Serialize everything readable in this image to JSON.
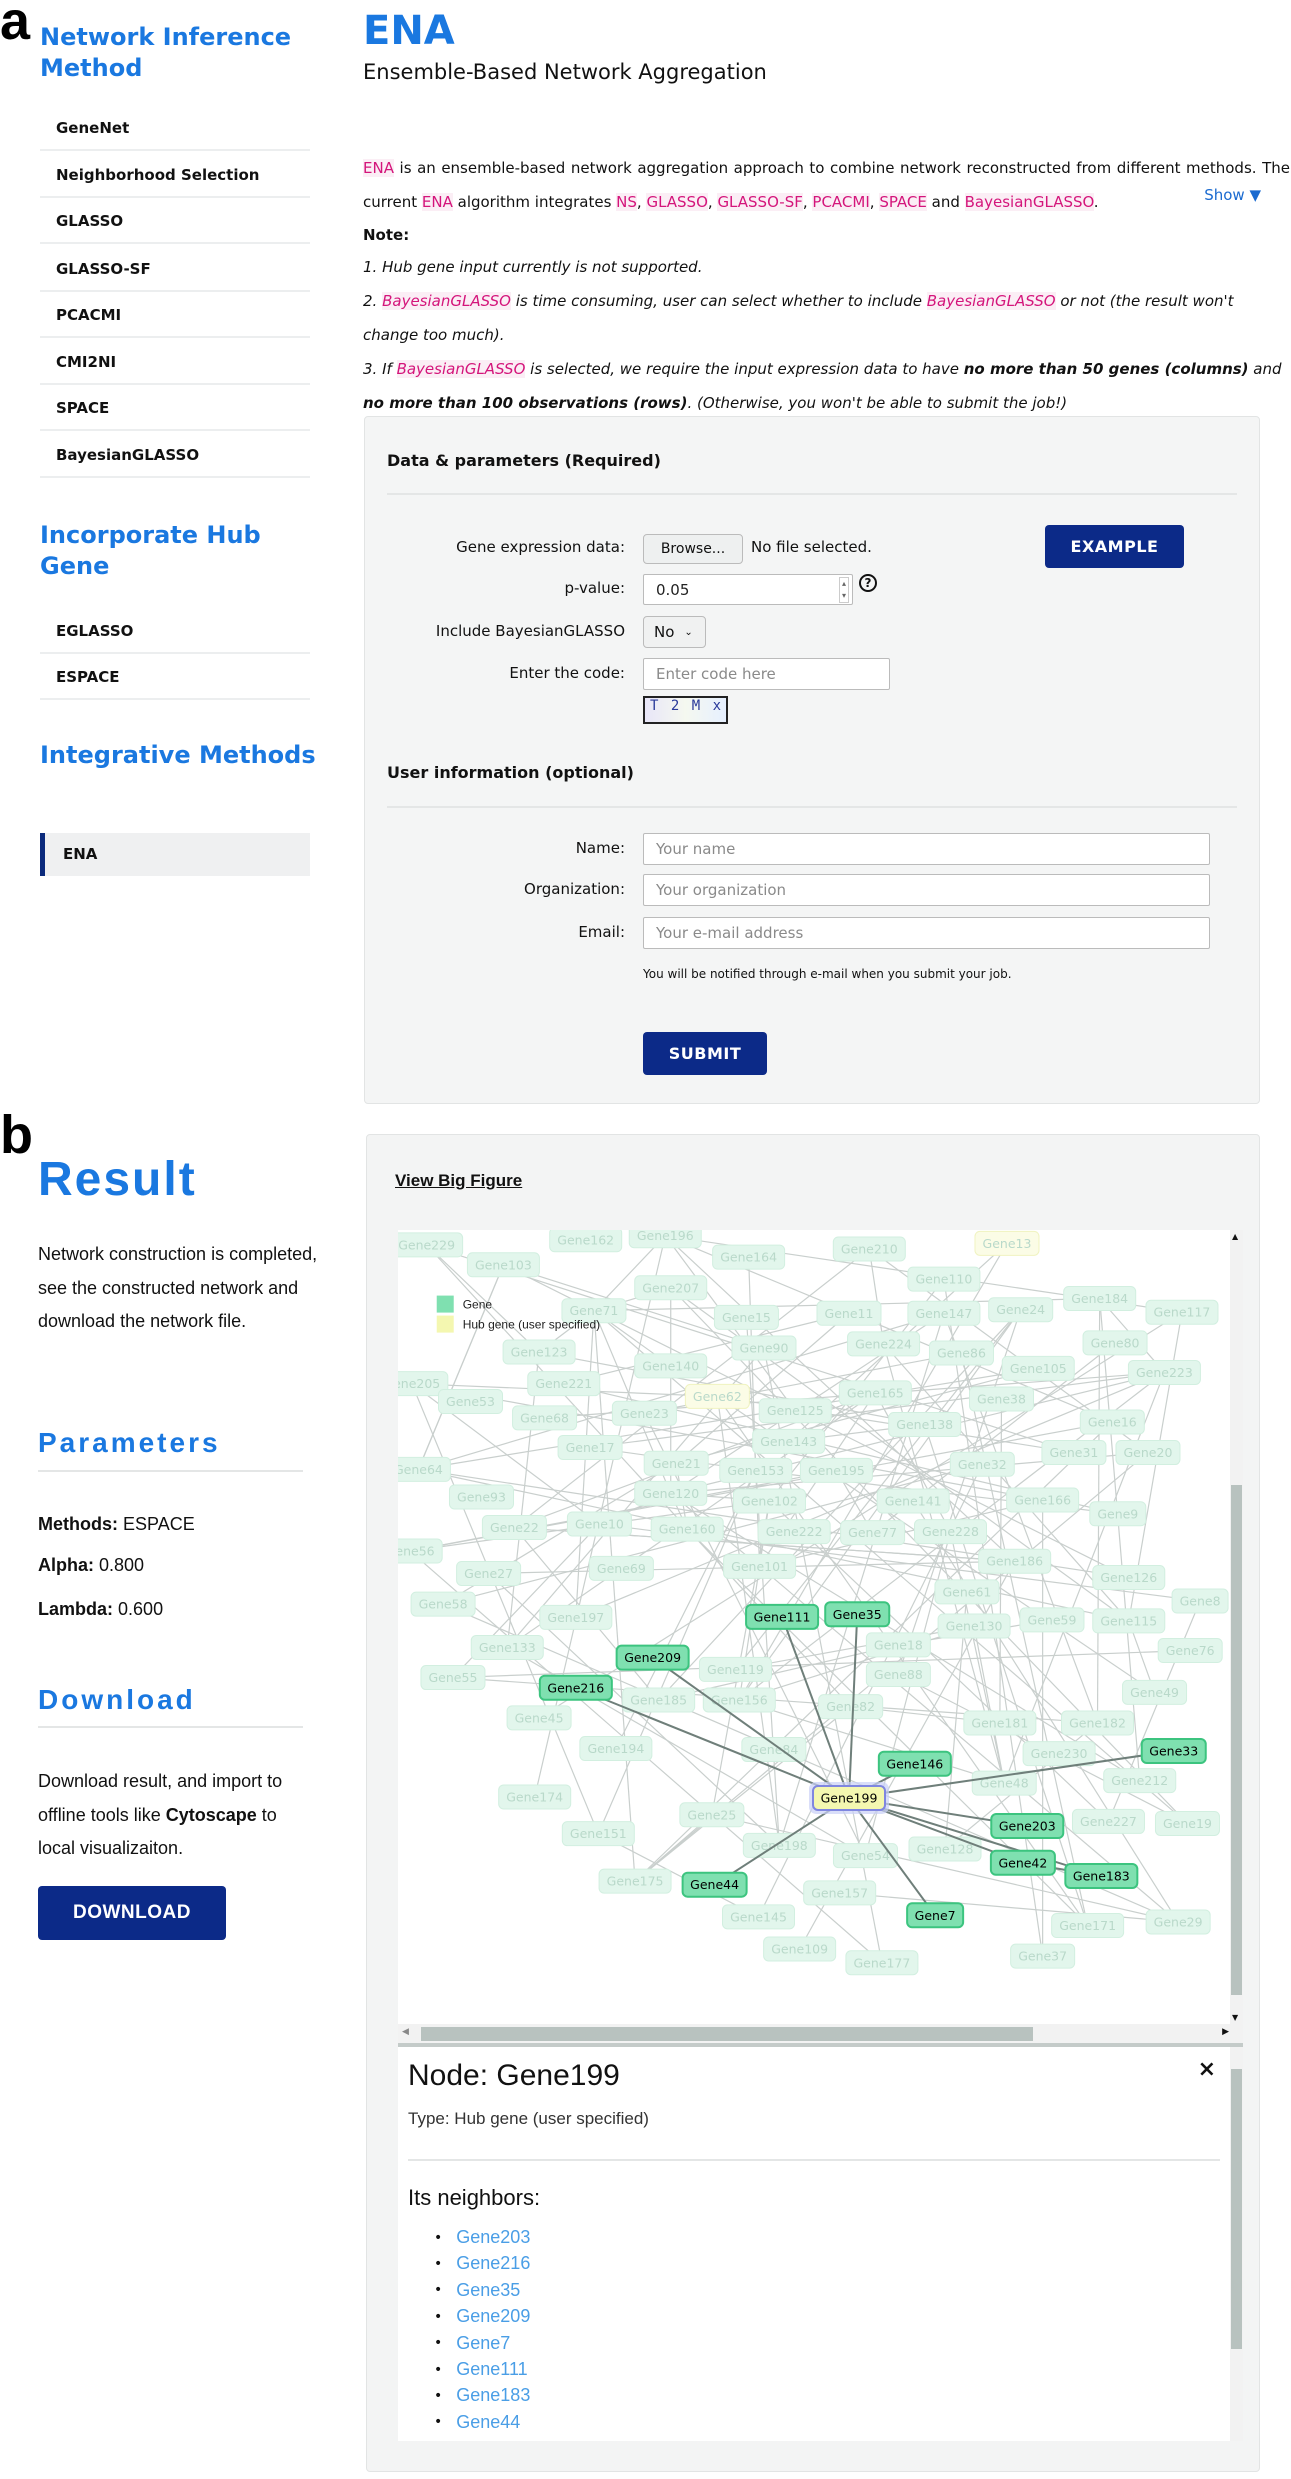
{
  "labels": {
    "a": "a",
    "b": "b"
  },
  "sidebar": {
    "section1": "Network Inference Method",
    "items1": [
      "GeneNet",
      "Neighborhood Selection",
      "GLASSO",
      "GLASSO-SF",
      "PCACMI",
      "CMI2NI",
      "SPACE",
      "BayesianGLASSO"
    ],
    "section2": "Incorporate Hub Gene",
    "items2": [
      "EGLASSO",
      "ESPACE"
    ],
    "section3": "Integrative Methods",
    "items3": [
      "ENA"
    ],
    "active_item": "ENA"
  },
  "header": {
    "title": "ENA",
    "subtitle": "Ensemble-Based Network Aggregation"
  },
  "intro": [
    {
      "t": "ENA",
      "s": "pink"
    },
    {
      "t": " is an ensemble-based network aggregation approach to combine network reconstructed from different methods. The current "
    },
    {
      "t": "ENA",
      "s": "pink"
    },
    {
      "t": " algorithm integrates "
    },
    {
      "t": "NS",
      "s": "pink"
    },
    {
      "t": ", "
    },
    {
      "t": "GLASSO",
      "s": "pink"
    },
    {
      "t": ", "
    },
    {
      "t": "GLASSO-SF",
      "s": "pink"
    },
    {
      "t": ", "
    },
    {
      "t": "PCACMI",
      "s": "pink"
    },
    {
      "t": ", "
    },
    {
      "t": "SPACE",
      "s": "pink"
    },
    {
      "t": " and "
    },
    {
      "t": "BayesianGLASSO",
      "s": "pink"
    },
    {
      "t": "."
    }
  ],
  "show_toggle": "Show ▼",
  "note": {
    "title": "Note:",
    "lines": [
      [
        {
          "t": "1. Hub gene input currently is not supported."
        }
      ],
      [
        {
          "t": "2. "
        },
        {
          "t": "BayesianGLASSO",
          "s": "pink"
        },
        {
          "t": " is time consuming, user can select whether to include "
        },
        {
          "t": "BayesianGLASSO",
          "s": "pink"
        },
        {
          "t": " or not (the result won't change too much)."
        }
      ],
      [
        {
          "t": "3. If "
        },
        {
          "t": "BayesianGLASSO",
          "s": "pink"
        },
        {
          "t": " is selected, we require the input expression data to have "
        },
        {
          "t": "no more than 50 genes (columns)",
          "s": "b"
        },
        {
          "t": " and "
        },
        {
          "t": "no more than 100 observations (rows)",
          "s": "b"
        },
        {
          "t": ". (Otherwise, you won't be able to submit the job!)"
        }
      ]
    ]
  },
  "form": {
    "section_required": "Data & parameters (Required)",
    "gene_expr_label": "Gene expression data:",
    "browse_label": "Browse...",
    "no_file": "No file selected.",
    "example_label": "EXAMPLE",
    "pvalue_label": "p-value:",
    "pvalue_value": "0.05",
    "help_icon": "?",
    "bayes_label": "Include BayesianGLASSO",
    "bayes_value": "No",
    "code_label": "Enter the code:",
    "code_placeholder": "Enter code here",
    "captcha": "T 2 M x",
    "section_optional": "User information (optional)",
    "name_label": "Name:",
    "name_placeholder": "Your name",
    "org_label": "Organization:",
    "org_placeholder": "Your organization",
    "email_label": "Email:",
    "email_placeholder": "Your e-mail address",
    "notify_text": "You will be notified through e-mail when you submit your job.",
    "submit_label": "SUBMIT"
  },
  "result": {
    "title": "Result",
    "description": "Network construction is completed, see the constructed network and download the network file.",
    "parameters_title": "Parameters",
    "params": [
      {
        "key": "Methods:",
        "value": "ESPACE"
      },
      {
        "key": "Alpha:",
        "value": "0.800"
      },
      {
        "key": "Lambda:",
        "value": "0.600"
      }
    ],
    "download_title": "Download",
    "download_text_1": "Download result, and import to offline tools like ",
    "download_text_bold": "Cytoscape",
    "download_text_2": " to local visualizaiton.",
    "download_label": "DOWNLOAD"
  },
  "network": {
    "view_big_figure": "View Big Figure",
    "legend": [
      {
        "label": "Gene",
        "color": "#7fe0b0"
      },
      {
        "label": "Hub gene (user specified)",
        "color": "#f4f7b0"
      }
    ],
    "colors": {
      "gene": "#7fe0b0",
      "hub": "#f4f7b0",
      "faded": "#e2f6ec",
      "edge": "#9aa6a2"
    },
    "selected": "Gene199",
    "highlighted": [
      "Gene199",
      "Gene111",
      "Gene35",
      "Gene209",
      "Gene216",
      "Gene146",
      "Gene33",
      "Gene203",
      "Gene42",
      "Gene183",
      "Gene44",
      "Gene7"
    ],
    "highlighted_edges": [
      [
        "Gene199",
        "Gene111"
      ],
      [
        "Gene199",
        "Gene35"
      ],
      [
        "Gene199",
        "Gene209"
      ],
      [
        "Gene199",
        "Gene216"
      ],
      [
        "Gene199",
        "Gene146"
      ],
      [
        "Gene199",
        "Gene33"
      ],
      [
        "Gene199",
        "Gene203"
      ],
      [
        "Gene199",
        "Gene42"
      ],
      [
        "Gene199",
        "Gene183"
      ],
      [
        "Gene199",
        "Gene44"
      ],
      [
        "Gene199",
        "Gene7"
      ],
      [
        "Gene42",
        "Gene183"
      ]
    ],
    "faded_hubs": [
      "Gene13",
      "Gene62"
    ],
    "faded": [
      "Gene229",
      "Gene162",
      "Gene196",
      "Gene103",
      "Gene164",
      "Gene210",
      "Gene13",
      "Gene207",
      "Gene71",
      "Gene110",
      "Gene15",
      "Gene11",
      "Gene147",
      "Gene24",
      "Gene184",
      "Gene117",
      "Gene123",
      "Gene90",
      "Gene224",
      "Gene86",
      "Gene80",
      "Gene140",
      "Gene105",
      "Gene223",
      "Gene205",
      "Gene221",
      "Gene53",
      "Gene62",
      "Gene165",
      "Gene38",
      "Gene68",
      "Gene23",
      "Gene125",
      "Gene138",
      "Gene16",
      "Gene17",
      "Gene143",
      "Gene31",
      "Gene20",
      "Gene32",
      "Gene64",
      "Gene21",
      "Gene153",
      "Gene195",
      "Gene93",
      "Gene120",
      "Gene102",
      "Gene141",
      "Gene166",
      "Gene9",
      "Gene22",
      "Gene10",
      "Gene160",
      "Gene222",
      "Gene77",
      "Gene228",
      "Gene56",
      "Gene186",
      "Gene27",
      "Gene69",
      "Gene101",
      "Gene126",
      "Gene58",
      "Gene61",
      "Gene197",
      "Gene130",
      "Gene59",
      "Gene115",
      "Gene8",
      "Gene133",
      "Gene18",
      "Gene76",
      "Gene55",
      "Gene119",
      "Gene88",
      "Gene185",
      "Gene156",
      "Gene82",
      "Gene49",
      "Gene45",
      "Gene181",
      "Gene182",
      "Gene194",
      "Gene84",
      "Gene230",
      "Gene48",
      "Gene212",
      "Gene174",
      "Gene25",
      "Gene227",
      "Gene19",
      "Gene151",
      "Gene198",
      "Gene54",
      "Gene128",
      "Gene175",
      "Gene157",
      "Gene145",
      "Gene171",
      "Gene29",
      "Gene109",
      "Gene177",
      "Gene37"
    ]
  },
  "node_panel": {
    "title": "Node: Gene199",
    "type": "Type: Hub gene (user specified)",
    "close_icon": "×",
    "neighbors_title": "Its neighbors:",
    "neighbors": [
      "Gene203",
      "Gene216",
      "Gene35",
      "Gene209",
      "Gene7",
      "Gene111",
      "Gene183",
      "Gene44"
    ]
  }
}
